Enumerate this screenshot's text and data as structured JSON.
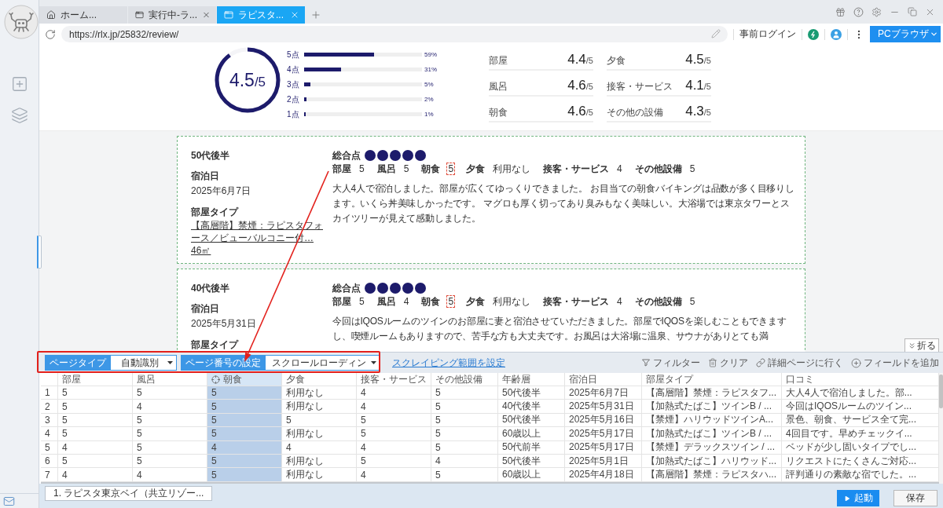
{
  "browser": {
    "tabs": [
      {
        "label": "ホーム...",
        "kind": "home",
        "selected": false
      },
      {
        "label": "実行中-ラ...",
        "kind": "page",
        "selected": false
      },
      {
        "label": "ラピスタ...",
        "kind": "page",
        "selected": true
      }
    ],
    "url": "https://rlx.jp/25832/review/",
    "login_label": "事前ログイン",
    "mode_button": "PCブラウザ"
  },
  "summary": {
    "overall": {
      "score": "4.5",
      "max": "/5"
    },
    "distribution": [
      {
        "label": "5点",
        "level": 0.59,
        "percent": "59%"
      },
      {
        "label": "4点",
        "level": 0.31,
        "percent": "31%"
      },
      {
        "label": "3点",
        "level": 0.05,
        "percent": "5%"
      },
      {
        "label": "2点",
        "level": 0.02,
        "percent": "2%"
      },
      {
        "label": "1点",
        "level": 0.01,
        "percent": "1%"
      }
    ],
    "categories": [
      {
        "label": "部屋",
        "score": "4.4",
        "max": "/5"
      },
      {
        "label": "夕食",
        "score": "4.5",
        "max": "/5"
      },
      {
        "label": "風呂",
        "score": "4.6",
        "max": "/5"
      },
      {
        "label": "接客・サービス",
        "score": "4.1",
        "max": "/5"
      },
      {
        "label": "朝食",
        "score": "4.6",
        "max": "/5"
      },
      {
        "label": "その他の設備",
        "score": "4.3",
        "max": "/5"
      }
    ]
  },
  "reviews": [
    {
      "age": "50代後半",
      "stay_label": "宿泊日",
      "stay_date": "2025年6月7日",
      "room_label": "部屋タイプ",
      "room_type": "【高層階】禁煙：ラピスタフォース／ビューバルコニー付…",
      "room_size": "46㎡",
      "overall_label": "総合点",
      "stars": 5,
      "scores": [
        {
          "label": "部屋",
          "value": "5",
          "highlighted": false
        },
        {
          "label": "風呂",
          "value": "5",
          "highlighted": false
        },
        {
          "label": "朝食",
          "value": "5",
          "highlighted": true
        },
        {
          "label": "夕食",
          "value": "利用なし",
          "highlighted": false
        },
        {
          "label": "接客・サービス",
          "value": "4",
          "highlighted": false
        },
        {
          "label": "その他設備",
          "value": "5",
          "highlighted": false
        }
      ],
      "comment": "大人4人で宿泊しました。部屋が広くてゆっくりできました。 お目当ての朝食バイキングは品数が多く目移りします。いくら丼美味しかったです。 マグロも厚く切ってあり臭みもなく美味しい。大浴場では東京タワーとスカイツリーが見えて感動しました。"
    },
    {
      "age": "40代後半",
      "stay_label": "宿泊日",
      "stay_date": "2025年5月31日",
      "room_label": "部屋タイプ",
      "overall_label": "総合点",
      "stars": 5,
      "scores": [
        {
          "label": "部屋",
          "value": "5",
          "highlighted": false
        },
        {
          "label": "風呂",
          "value": "4",
          "highlighted": false
        },
        {
          "label": "朝食",
          "value": "5",
          "highlighted": true
        },
        {
          "label": "夕食",
          "value": "利用なし",
          "highlighted": false
        },
        {
          "label": "接客・サービス",
          "value": "4",
          "highlighted": false
        },
        {
          "label": "その他設備",
          "value": "5",
          "highlighted": false
        }
      ],
      "comment": "今回はIQOSルームのツインのお部屋に妻と宿泊させていただきました。部屋でIQOSを楽しむこともできますし、喫煙ルームもありますので、苦手な方も大丈夫です。お風呂は大浴場に温泉、サウナがありとても満"
    }
  ],
  "fold_button": "折る",
  "toolbar": {
    "selects": [
      {
        "label": "ページタイプ",
        "value": "自動識別"
      },
      {
        "label": "ページ番号の設定",
        "value": "スクロールローディン"
      }
    ],
    "range_link": "スクレイピング範囲を設定",
    "actions": [
      {
        "kind": "filter",
        "label": "フィルター"
      },
      {
        "kind": "clear",
        "label": "クリア"
      },
      {
        "kind": "link",
        "label": "詳細ページに行く"
      },
      {
        "kind": "add",
        "label": "フィールドを追加"
      }
    ]
  },
  "table": {
    "columns": [
      {
        "label": "部屋",
        "selected": false
      },
      {
        "label": "風呂",
        "selected": false
      },
      {
        "label": "朝食",
        "selected": true
      },
      {
        "label": "夕食",
        "selected": false
      },
      {
        "label": "接客・サービス",
        "selected": false
      },
      {
        "label": "その他設備",
        "selected": false
      },
      {
        "label": "年齢層",
        "selected": false
      },
      {
        "label": "宿泊日",
        "selected": false
      },
      {
        "label": "部屋タイプ",
        "selected": false
      },
      {
        "label": "口コミ",
        "selected": false
      }
    ],
    "rows": [
      {
        "index": "1",
        "cells": [
          "5",
          "5",
          "5",
          "利用なし",
          "4",
          "5",
          "50代後半",
          "2025年6月7日",
          "【高層階】禁煙：ラピスタフ...",
          "大人4人で宿泊しました。部..."
        ]
      },
      {
        "index": "2",
        "cells": [
          "5",
          "4",
          "5",
          "利用なし",
          "4",
          "5",
          "40代後半",
          "2025年5月31日",
          "【加熱式たばこ】ツインB / ...",
          "今回はIQOSルームのツイン..."
        ]
      },
      {
        "index": "3",
        "cells": [
          "5",
          "5",
          "5",
          "5",
          "5",
          "5",
          "50代後半",
          "2025年5月16日",
          "【禁煙】ハリウッドツインA...",
          "景色、朝食、サービス全て完..."
        ]
      },
      {
        "index": "4",
        "cells": [
          "5",
          "5",
          "5",
          "利用なし",
          "5",
          "5",
          "60歳以上",
          "2025年5月17日",
          "【加熱式たばこ】ツインB / ...",
          "4回目です。早めチェックイ..."
        ]
      },
      {
        "index": "5",
        "cells": [
          "4",
          "5",
          "4",
          "4",
          "4",
          "5",
          "50代前半",
          "2025年5月17日",
          "【禁煙】デラックスツイン / ...",
          "ベッドが少し固いタイプでし..."
        ]
      },
      {
        "index": "6",
        "cells": [
          "5",
          "5",
          "5",
          "利用なし",
          "5",
          "4",
          "50代後半",
          "2025年5月1日",
          "【加熱式たばこ】ハリウッド...",
          "リクエストにたくさんご対応..."
        ]
      },
      {
        "index": "7",
        "cells": [
          "4",
          "4",
          "5",
          "利用なし",
          "4",
          "5",
          "60歳以上",
          "2025年4月18日",
          "【高層階】禁煙：ラピスタハ...",
          "評判通りの素敵な宿でした。..."
        ]
      }
    ]
  },
  "footer": {
    "task_tab": "1. ラピスタ東京ベイ（共立リゾー...",
    "run_button": "起動",
    "save_button": "保存"
  }
}
